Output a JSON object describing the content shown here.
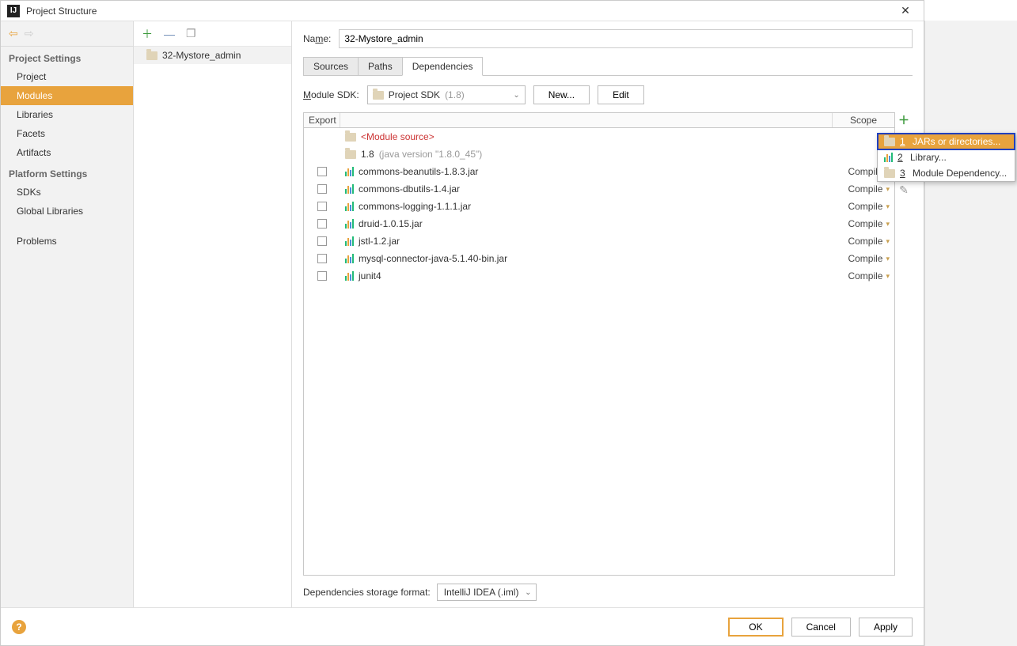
{
  "window": {
    "title": "Project Structure"
  },
  "nav": {
    "section1": "Project Settings",
    "items1": [
      "Project",
      "Modules",
      "Libraries",
      "Facets",
      "Artifacts"
    ],
    "selected1": 1,
    "section2": "Platform Settings",
    "items2": [
      "SDKs",
      "Global Libraries"
    ],
    "section3_item": "Problems"
  },
  "module_tree": {
    "module_name": "32-Mystore_admin"
  },
  "name": {
    "label_pre": "Na",
    "label_u": "m",
    "label_post": "e:",
    "value": "32-Mystore_admin"
  },
  "tabs": {
    "items": [
      "Sources",
      "Paths",
      "Dependencies"
    ],
    "active": 2
  },
  "sdk": {
    "label_u": "M",
    "label_post": "odule SDK:",
    "value": "Project SDK",
    "version": "(1.8)",
    "new_btn": "New...",
    "edit_btn": "Edit"
  },
  "deps_header": {
    "export": "Export",
    "scope": "Scope"
  },
  "deps": {
    "module_source": "<Module source>",
    "jdk_name": "1.8",
    "jdk_detail": "(java version \"1.8.0_45\")",
    "rows": [
      {
        "name": "commons-beanutils-1.8.3.jar",
        "scope": "Compile"
      },
      {
        "name": "commons-dbutils-1.4.jar",
        "scope": "Compile"
      },
      {
        "name": "commons-logging-1.1.1.jar",
        "scope": "Compile"
      },
      {
        "name": "druid-1.0.15.jar",
        "scope": "Compile"
      },
      {
        "name": "jstl-1.2.jar",
        "scope": "Compile"
      },
      {
        "name": "mysql-connector-java-5.1.40-bin.jar",
        "scope": "Compile"
      },
      {
        "name": "junit4",
        "scope": "Compile"
      }
    ]
  },
  "storage": {
    "label": "Dependencies storage format:",
    "value": "IntelliJ IDEA (.iml)"
  },
  "footer": {
    "ok": "OK",
    "cancel": "Cancel",
    "apply": "Apply"
  },
  "popup": {
    "items": [
      {
        "num": "1",
        "label": "JARs or directories..."
      },
      {
        "num": "2",
        "label": "Library..."
      },
      {
        "num": "3",
        "label": "Module Dependency..."
      }
    ],
    "selected": 0
  }
}
